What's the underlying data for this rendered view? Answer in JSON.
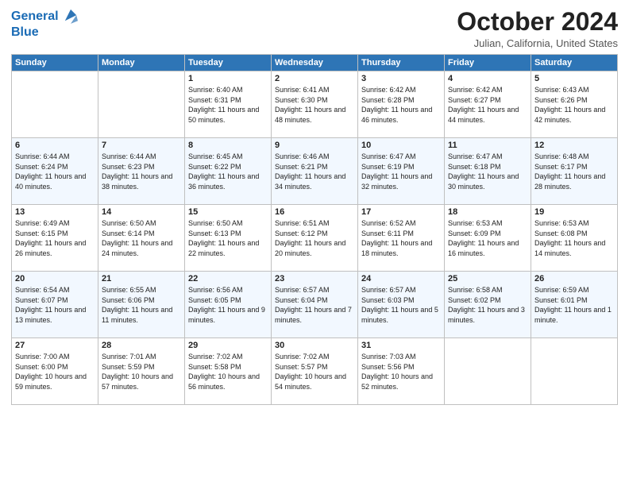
{
  "header": {
    "logo_line1_general": "General",
    "logo_line2_blue": "Blue",
    "month_title": "October 2024",
    "location": "Julian, California, United States"
  },
  "days_of_week": [
    "Sunday",
    "Monday",
    "Tuesday",
    "Wednesday",
    "Thursday",
    "Friday",
    "Saturday"
  ],
  "weeks": [
    [
      {
        "day": "",
        "content": ""
      },
      {
        "day": "",
        "content": ""
      },
      {
        "day": "1",
        "content": "Sunrise: 6:40 AM\nSunset: 6:31 PM\nDaylight: 11 hours and 50 minutes."
      },
      {
        "day": "2",
        "content": "Sunrise: 6:41 AM\nSunset: 6:30 PM\nDaylight: 11 hours and 48 minutes."
      },
      {
        "day": "3",
        "content": "Sunrise: 6:42 AM\nSunset: 6:28 PM\nDaylight: 11 hours and 46 minutes."
      },
      {
        "day": "4",
        "content": "Sunrise: 6:42 AM\nSunset: 6:27 PM\nDaylight: 11 hours and 44 minutes."
      },
      {
        "day": "5",
        "content": "Sunrise: 6:43 AM\nSunset: 6:26 PM\nDaylight: 11 hours and 42 minutes."
      }
    ],
    [
      {
        "day": "6",
        "content": "Sunrise: 6:44 AM\nSunset: 6:24 PM\nDaylight: 11 hours and 40 minutes."
      },
      {
        "day": "7",
        "content": "Sunrise: 6:44 AM\nSunset: 6:23 PM\nDaylight: 11 hours and 38 minutes."
      },
      {
        "day": "8",
        "content": "Sunrise: 6:45 AM\nSunset: 6:22 PM\nDaylight: 11 hours and 36 minutes."
      },
      {
        "day": "9",
        "content": "Sunrise: 6:46 AM\nSunset: 6:21 PM\nDaylight: 11 hours and 34 minutes."
      },
      {
        "day": "10",
        "content": "Sunrise: 6:47 AM\nSunset: 6:19 PM\nDaylight: 11 hours and 32 minutes."
      },
      {
        "day": "11",
        "content": "Sunrise: 6:47 AM\nSunset: 6:18 PM\nDaylight: 11 hours and 30 minutes."
      },
      {
        "day": "12",
        "content": "Sunrise: 6:48 AM\nSunset: 6:17 PM\nDaylight: 11 hours and 28 minutes."
      }
    ],
    [
      {
        "day": "13",
        "content": "Sunrise: 6:49 AM\nSunset: 6:15 PM\nDaylight: 11 hours and 26 minutes."
      },
      {
        "day": "14",
        "content": "Sunrise: 6:50 AM\nSunset: 6:14 PM\nDaylight: 11 hours and 24 minutes."
      },
      {
        "day": "15",
        "content": "Sunrise: 6:50 AM\nSunset: 6:13 PM\nDaylight: 11 hours and 22 minutes."
      },
      {
        "day": "16",
        "content": "Sunrise: 6:51 AM\nSunset: 6:12 PM\nDaylight: 11 hours and 20 minutes."
      },
      {
        "day": "17",
        "content": "Sunrise: 6:52 AM\nSunset: 6:11 PM\nDaylight: 11 hours and 18 minutes."
      },
      {
        "day": "18",
        "content": "Sunrise: 6:53 AM\nSunset: 6:09 PM\nDaylight: 11 hours and 16 minutes."
      },
      {
        "day": "19",
        "content": "Sunrise: 6:53 AM\nSunset: 6:08 PM\nDaylight: 11 hours and 14 minutes."
      }
    ],
    [
      {
        "day": "20",
        "content": "Sunrise: 6:54 AM\nSunset: 6:07 PM\nDaylight: 11 hours and 13 minutes."
      },
      {
        "day": "21",
        "content": "Sunrise: 6:55 AM\nSunset: 6:06 PM\nDaylight: 11 hours and 11 minutes."
      },
      {
        "day": "22",
        "content": "Sunrise: 6:56 AM\nSunset: 6:05 PM\nDaylight: 11 hours and 9 minutes."
      },
      {
        "day": "23",
        "content": "Sunrise: 6:57 AM\nSunset: 6:04 PM\nDaylight: 11 hours and 7 minutes."
      },
      {
        "day": "24",
        "content": "Sunrise: 6:57 AM\nSunset: 6:03 PM\nDaylight: 11 hours and 5 minutes."
      },
      {
        "day": "25",
        "content": "Sunrise: 6:58 AM\nSunset: 6:02 PM\nDaylight: 11 hours and 3 minutes."
      },
      {
        "day": "26",
        "content": "Sunrise: 6:59 AM\nSunset: 6:01 PM\nDaylight: 11 hours and 1 minute."
      }
    ],
    [
      {
        "day": "27",
        "content": "Sunrise: 7:00 AM\nSunset: 6:00 PM\nDaylight: 10 hours and 59 minutes."
      },
      {
        "day": "28",
        "content": "Sunrise: 7:01 AM\nSunset: 5:59 PM\nDaylight: 10 hours and 57 minutes."
      },
      {
        "day": "29",
        "content": "Sunrise: 7:02 AM\nSunset: 5:58 PM\nDaylight: 10 hours and 56 minutes."
      },
      {
        "day": "30",
        "content": "Sunrise: 7:02 AM\nSunset: 5:57 PM\nDaylight: 10 hours and 54 minutes."
      },
      {
        "day": "31",
        "content": "Sunrise: 7:03 AM\nSunset: 5:56 PM\nDaylight: 10 hours and 52 minutes."
      },
      {
        "day": "",
        "content": ""
      },
      {
        "day": "",
        "content": ""
      }
    ]
  ]
}
